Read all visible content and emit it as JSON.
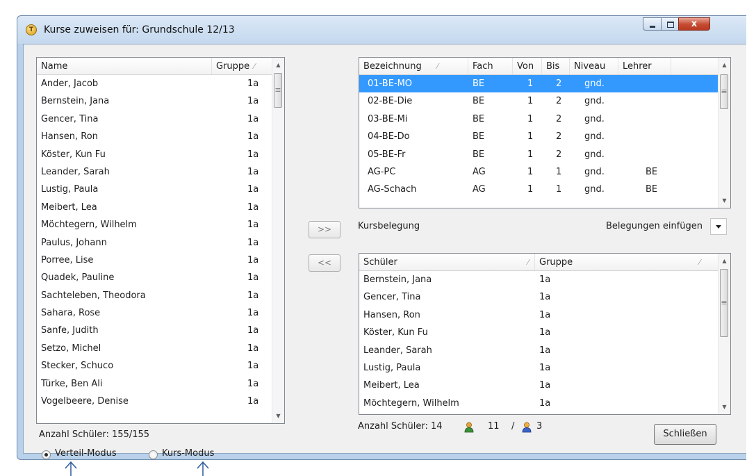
{
  "window": {
    "title": "Kurse zuweisen für: Grundschule 12/13",
    "close_glyph": "x"
  },
  "students_list": {
    "columns": {
      "name": "Name",
      "group": "Gruppe"
    },
    "rows": [
      {
        "name": "Ander, Jacob",
        "group": "1a"
      },
      {
        "name": "Bernstein, Jana",
        "group": "1a"
      },
      {
        "name": "Gencer, Tina",
        "group": "1a"
      },
      {
        "name": "Hansen, Ron",
        "group": "1a"
      },
      {
        "name": "Köster, Kun Fu",
        "group": "1a"
      },
      {
        "name": "Leander, Sarah",
        "group": "1a"
      },
      {
        "name": "Lustig, Paula",
        "group": "1a"
      },
      {
        "name": "Meibert, Lea",
        "group": "1a"
      },
      {
        "name": "Möchtegern, Wilhelm",
        "group": "1a"
      },
      {
        "name": "Paulus, Johann",
        "group": "1a"
      },
      {
        "name": "Porree, Lise",
        "group": "1a"
      },
      {
        "name": "Quadek, Pauline",
        "group": "1a"
      },
      {
        "name": "Sachteleben, Theodora",
        "group": "1a"
      },
      {
        "name": "Sahara, Rose",
        "group": "1a"
      },
      {
        "name": "Sanfe, Judith",
        "group": "1a"
      },
      {
        "name": "Setzo, Michel",
        "group": "1a"
      },
      {
        "name": "Stecker, Schuco",
        "group": "1a"
      },
      {
        "name": "Türke, Ben Ali",
        "group": "1a"
      },
      {
        "name": "Vogelbeere, Denise",
        "group": "1a"
      }
    ],
    "count_text": "Anzahl Schüler: 155/155"
  },
  "mode": {
    "distribute_label": "Verteil-Modus",
    "course_label": "Kurs-Modus",
    "selected": "distribute"
  },
  "buttons": {
    "add": ">>",
    "remove": "<<",
    "close": "Schließen"
  },
  "courses_list": {
    "columns": {
      "name": "Bezeichnung",
      "subject": "Fach",
      "from": "Von",
      "to": "Bis",
      "level": "Niveau",
      "teacher": "Lehrer"
    },
    "rows": [
      {
        "name": "01-BE-MO",
        "subject": "BE",
        "from": "1",
        "to": "2",
        "level": "gnd.",
        "teacher": "",
        "selected": true
      },
      {
        "name": "02-BE-Die",
        "subject": "BE",
        "from": "1",
        "to": "2",
        "level": "gnd.",
        "teacher": ""
      },
      {
        "name": "03-BE-Mi",
        "subject": "BE",
        "from": "1",
        "to": "2",
        "level": "gnd.",
        "teacher": ""
      },
      {
        "name": "04-BE-Do",
        "subject": "BE",
        "from": "1",
        "to": "2",
        "level": "gnd.",
        "teacher": ""
      },
      {
        "name": "05-BE-Fr",
        "subject": "BE",
        "from": "1",
        "to": "2",
        "level": "gnd.",
        "teacher": ""
      },
      {
        "name": "AG-PC",
        "subject": "AG",
        "from": "1",
        "to": "1",
        "level": "gnd.",
        "teacher": "BE"
      },
      {
        "name": "AG-Schach",
        "subject": "AG",
        "from": "1",
        "to": "1",
        "level": "gnd.",
        "teacher": "BE"
      }
    ]
  },
  "assignment": {
    "heading": "Kursbelegung",
    "insert_label": "Belegungen einfügen",
    "columns": {
      "student": "Schüler",
      "group": "Gruppe"
    },
    "rows": [
      {
        "name": "Bernstein, Jana",
        "group": "1a"
      },
      {
        "name": "Gencer, Tina",
        "group": "1a"
      },
      {
        "name": "Hansen, Ron",
        "group": "1a"
      },
      {
        "name": "Köster, Kun Fu",
        "group": "1a"
      },
      {
        "name": "Leander, Sarah",
        "group": "1a"
      },
      {
        "name": "Lustig, Paula",
        "group": "1a"
      },
      {
        "name": "Meibert, Lea",
        "group": "1a"
      },
      {
        "name": "Möchtegern, Wilhelm",
        "group": "1a"
      }
    ],
    "count_text": "Anzahl Schüler: 14",
    "male_count": "11",
    "separator": "/",
    "female_count": "3"
  },
  "colors": {
    "selection": "#3399ff",
    "title_bar": "#c4d8ee",
    "close_button": "#c44a31"
  }
}
